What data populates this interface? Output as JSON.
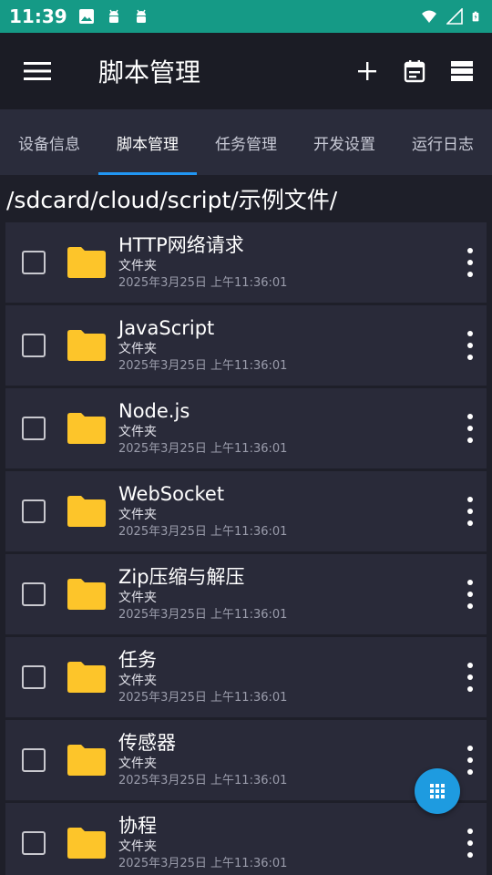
{
  "status_bar": {
    "time": "11:39",
    "bg_color": "#159a86",
    "left_icons": [
      "image-icon",
      "android-icon",
      "android-icon"
    ],
    "right_icons": [
      "wifi-icon",
      "signal-icon",
      "battery-icon"
    ]
  },
  "app_bar": {
    "title": "脚本管理",
    "menu_icon": "menu-icon",
    "actions": [
      "add-icon",
      "calendar-icon",
      "list-view-icon"
    ]
  },
  "tabs": [
    {
      "label": "设备信息",
      "active": false
    },
    {
      "label": "脚本管理",
      "active": true
    },
    {
      "label": "任务管理",
      "active": false
    },
    {
      "label": "开发设置",
      "active": false
    },
    {
      "label": "运行日志",
      "active": false
    }
  ],
  "path": "/sdcard/cloud/script/示例文件/",
  "files": [
    {
      "name": "HTTP网络请求",
      "type": "文件夹",
      "date": "2025年3月25日 上午11:36:01"
    },
    {
      "name": "JavaScript",
      "type": "文件夹",
      "date": "2025年3月25日 上午11:36:01"
    },
    {
      "name": "Node.js",
      "type": "文件夹",
      "date": "2025年3月25日 上午11:36:01"
    },
    {
      "name": "WebSocket",
      "type": "文件夹",
      "date": "2025年3月25日 上午11:36:01"
    },
    {
      "name": "Zip压缩与解压",
      "type": "文件夹",
      "date": "2025年3月25日 上午11:36:01"
    },
    {
      "name": "任务",
      "type": "文件夹",
      "date": "2025年3月25日 上午11:36:01"
    },
    {
      "name": "传感器",
      "type": "文件夹",
      "date": "2025年3月25日 上午11:36:01"
    },
    {
      "name": "协程",
      "type": "文件夹",
      "date": "2025年3月25日 上午11:36:01"
    }
  ],
  "colors": {
    "accent": "#2196f3",
    "folder": "#fdc52a",
    "fab": "#1e9be0"
  },
  "fab_icon": "grid-icon"
}
